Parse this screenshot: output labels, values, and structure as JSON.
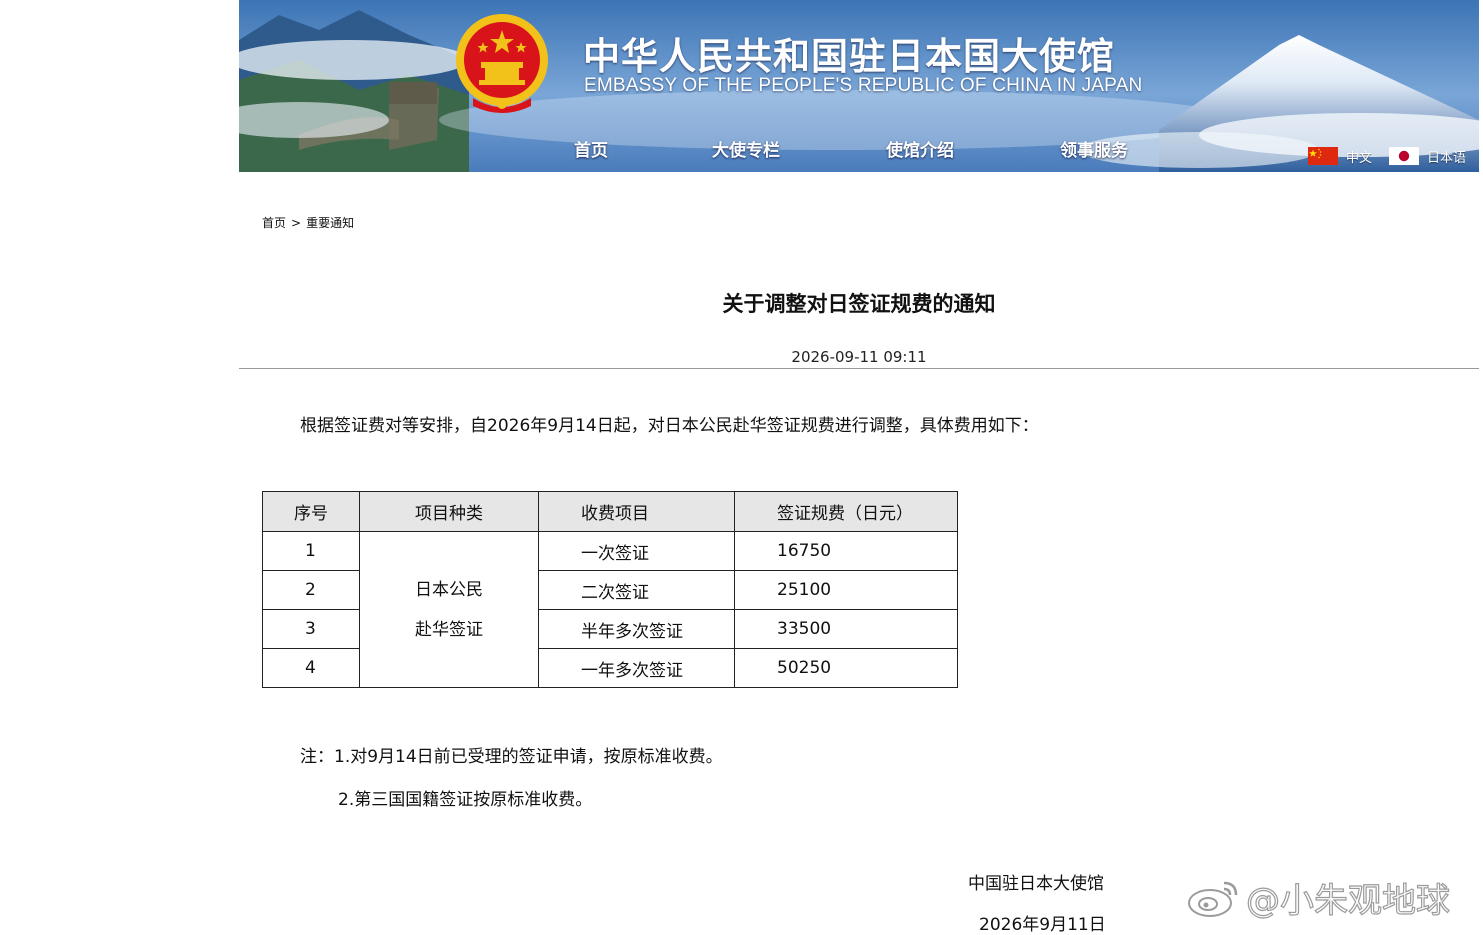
{
  "header": {
    "title_cn": "中华人民共和国驻日本国大使馆",
    "title_en": "EMBASSY OF THE PEOPLE'S REPUBLIC OF CHINA IN JAPAN",
    "nav": [
      "首页",
      "大使专栏",
      "使馆介绍",
      "领事服务"
    ],
    "languages": [
      {
        "label": "中文",
        "flag": "china-flag-icon"
      },
      {
        "label": "日本语",
        "flag": "japan-flag-icon"
      }
    ],
    "colors": {
      "banner_blue": "#3f78b8",
      "emblem_red": "#d8131a",
      "emblem_gold": "#f2c21b"
    }
  },
  "breadcrumb": {
    "home": "首页",
    "separator": ">",
    "current": "重要通知"
  },
  "article": {
    "title": "关于调整对日签证规费的通知",
    "date": "2026-09-11 09:11",
    "lead": "根据签证费对等安排，自2026年9月14日起，对日本公民赴华签证规费进行调整，具体费用如下：",
    "table": {
      "headers": [
        "序号",
        "项目种类",
        "收费项目",
        "签证规费（日元）"
      ],
      "merged_category_line1": "日本公民",
      "merged_category_line2": "赴华签证",
      "rows": [
        {
          "no": "1",
          "item": "一次签证",
          "fee": "16750"
        },
        {
          "no": "2",
          "item": "二次签证",
          "fee": "25100"
        },
        {
          "no": "3",
          "item": "半年多次签证",
          "fee": "33500"
        },
        {
          "no": "4",
          "item": "一年多次签证",
          "fee": "50250"
        }
      ]
    },
    "note1": "注：1.对9月14日前已受理的签证申请，按原标准收费。",
    "note2": "2.第三国国籍签证按原标准收费。",
    "signature_org": "中国驻日本大使馆",
    "signature_date": "2026年9月11日"
  },
  "watermark": {
    "text": "@小朱观地球",
    "icon": "weibo-icon"
  }
}
